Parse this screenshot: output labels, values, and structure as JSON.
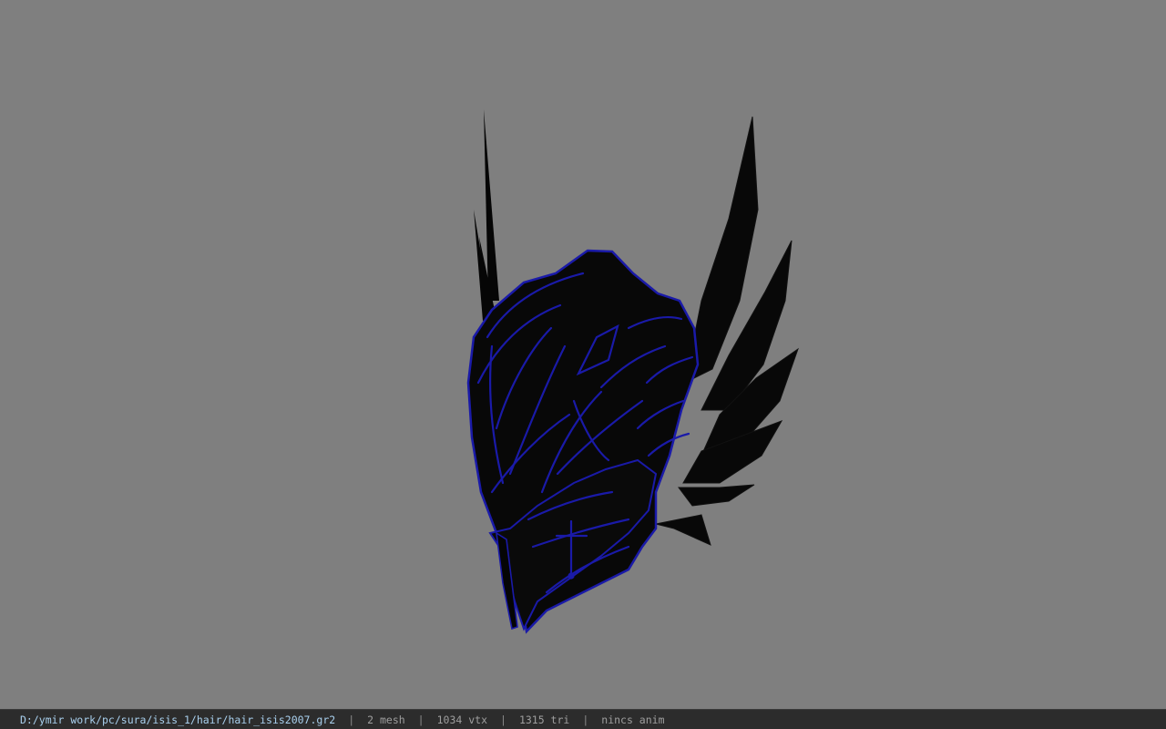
{
  "viewer": {
    "background_color": "#7f7f7f",
    "model": {
      "name": "hair_isis2007 helmet model",
      "base_color": "#080808",
      "trim_color": "#1a1aa8"
    }
  },
  "status_bar": {
    "file_path": "D:/ymir work/pc/sura/isis_1/hair/hair_isis2007.gr2",
    "separator": "|",
    "mesh_count": "2 mesh",
    "vertex_count": "1034 vtx",
    "triangle_count": "1315 tri",
    "anim_status": "nincs anim"
  }
}
